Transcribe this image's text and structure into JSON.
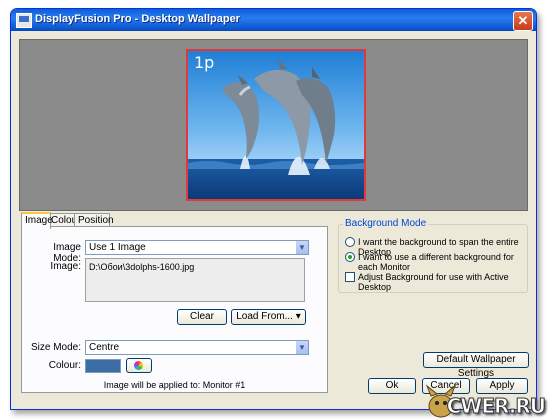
{
  "window": {
    "title": "DisplayFusion Pro - Desktop Wallpaper",
    "close_glyph": "✕"
  },
  "preview": {
    "monitor_label": "1p"
  },
  "tabs": [
    {
      "label": "Image",
      "active": true
    },
    {
      "label": "Colour",
      "active": false
    },
    {
      "label": "Position",
      "active": false
    }
  ],
  "image_panel": {
    "image_mode_label": "Image Mode:",
    "image_mode_value": "Use 1 Image",
    "image_label": "Image:",
    "image_path": "D:\\Обои\\3dolphs-1600.jpg",
    "clear_button": "Clear",
    "load_from_button": "Load From...",
    "size_mode_label": "Size Mode:",
    "size_mode_value": "Centre",
    "colour_label": "Colour:",
    "colour_value": "#3a6ea5",
    "applied_text": "Image will be applied to: Monitor #1"
  },
  "background_mode": {
    "title": "Background Mode",
    "option_span": "I want the background to span the entire Desktop",
    "option_each": "I want to use a different background for each Monitor",
    "selected": "option_each",
    "adjust_checkbox": "Adjust Background for use with Active Desktop",
    "adjust_checked": false
  },
  "buttons": {
    "default_wallpaper": "Default Wallpaper Settings",
    "ok": "Ok",
    "cancel": "Cancel",
    "apply": "Apply"
  },
  "watermark": {
    "text": "CWER.RU"
  },
  "icons": {
    "arrow_down": "▼",
    "load_arrow": "▾"
  }
}
